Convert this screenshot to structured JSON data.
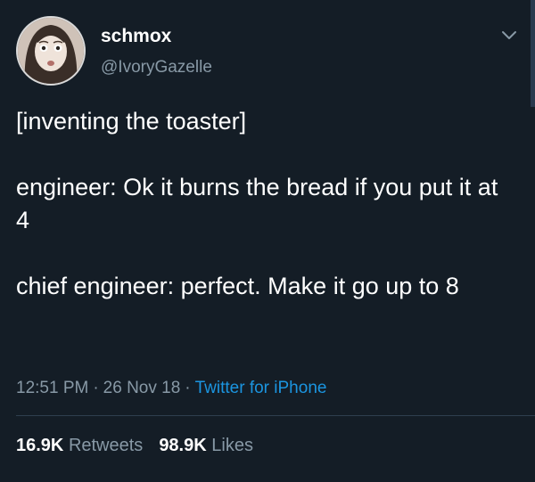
{
  "user": {
    "name": "schmox",
    "handle": "@IvoryGazelle"
  },
  "tweet": {
    "line1": "[inventing the toaster]",
    "line2": "engineer: Ok it burns the bread if you put it at 4",
    "line3": "chief engineer: perfect. Make it go up to 8",
    "time": "12:51 PM",
    "date": "26 Nov 18",
    "separator": "·",
    "source": "Twitter for iPhone"
  },
  "stats": {
    "retweets_count": "16.9K",
    "retweets_label": "Retweets",
    "likes_count": "98.9K",
    "likes_label": "Likes"
  },
  "icons": {
    "menu": "chevron-down-icon"
  },
  "colors": {
    "background": "#141d26",
    "muted": "#8899a6",
    "link": "#1b95e0"
  }
}
